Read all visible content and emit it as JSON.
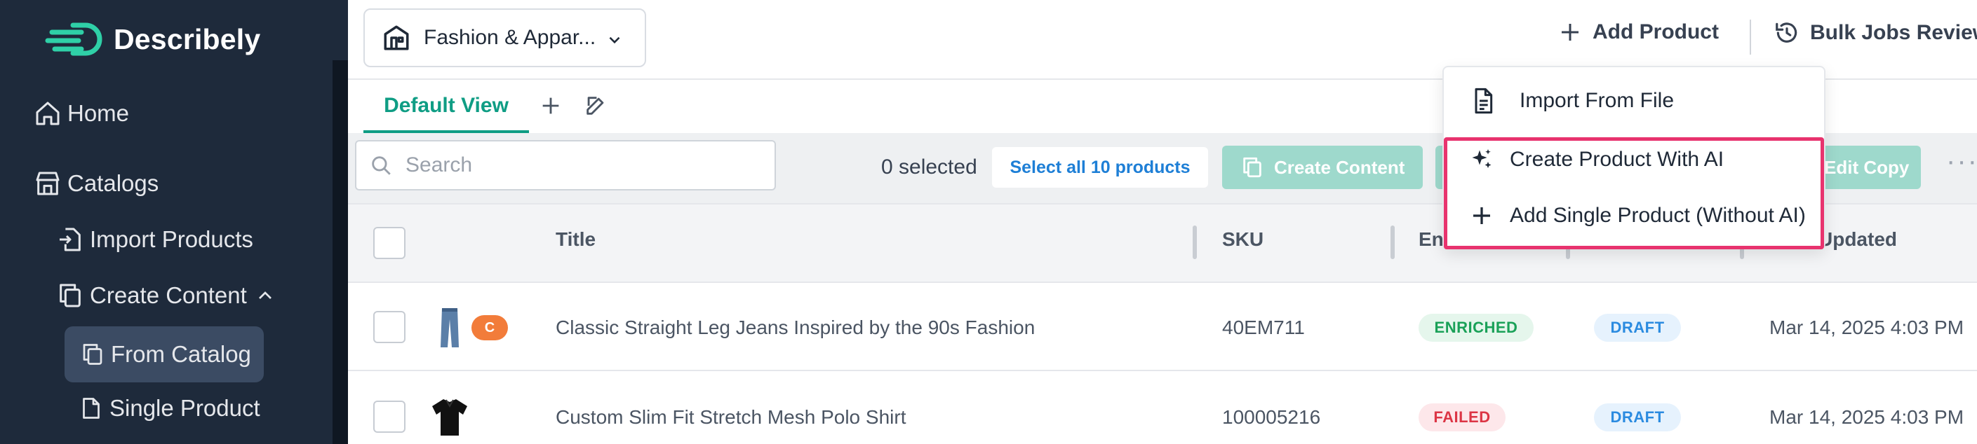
{
  "app": {
    "name": "Describely"
  },
  "sidebar": {
    "items": [
      {
        "label": "Home",
        "icon": "home-icon"
      },
      {
        "label": "Catalogs",
        "icon": "store-icon"
      },
      {
        "label": "Import Products",
        "icon": "import-icon"
      },
      {
        "label": "Create Content",
        "icon": "copy-icon",
        "expanded": true
      },
      {
        "label": "From Catalog",
        "icon": "copy-icon",
        "active": true
      },
      {
        "label": "Single Product",
        "icon": "file-icon"
      }
    ]
  },
  "header": {
    "store_selector": "Fashion & Appar...",
    "add_product": "Add Product",
    "bulk_jobs": "Bulk Jobs Review"
  },
  "tabs": {
    "active": "Default View"
  },
  "toolbar": {
    "search_placeholder": "Search",
    "selected_count": "0 selected",
    "select_all": "Select all 10 products",
    "create_content": "Create Content",
    "edit_copy": "Edit Copy"
  },
  "dropdown": {
    "items": [
      {
        "label": "Import From File",
        "icon": "file-text-icon"
      },
      {
        "label": "Create Product With AI",
        "icon": "sparkles-icon"
      },
      {
        "label": "Add Single Product (Without AI)",
        "icon": "plus-icon"
      }
    ]
  },
  "table": {
    "columns": [
      "Title",
      "SKU",
      "En",
      "Updated"
    ],
    "rows": [
      {
        "title": "Classic Straight Leg Jeans Inspired by the 90s Fashion",
        "sku": "40EM711",
        "status": "ENRICHED",
        "state": "DRAFT",
        "updated": "Mar 14, 2025 4:03 PM",
        "badge": "C"
      },
      {
        "title": "Custom Slim Fit Stretch Mesh Polo Shirt",
        "sku": "100005216",
        "status": "FAILED",
        "state": "DRAFT",
        "updated": "Mar 14, 2025 4:03 PM"
      }
    ]
  },
  "colors": {
    "sidebar_bg": "#1e2a3b",
    "accent": "#0f9d84",
    "highlight": "#e8336e"
  }
}
